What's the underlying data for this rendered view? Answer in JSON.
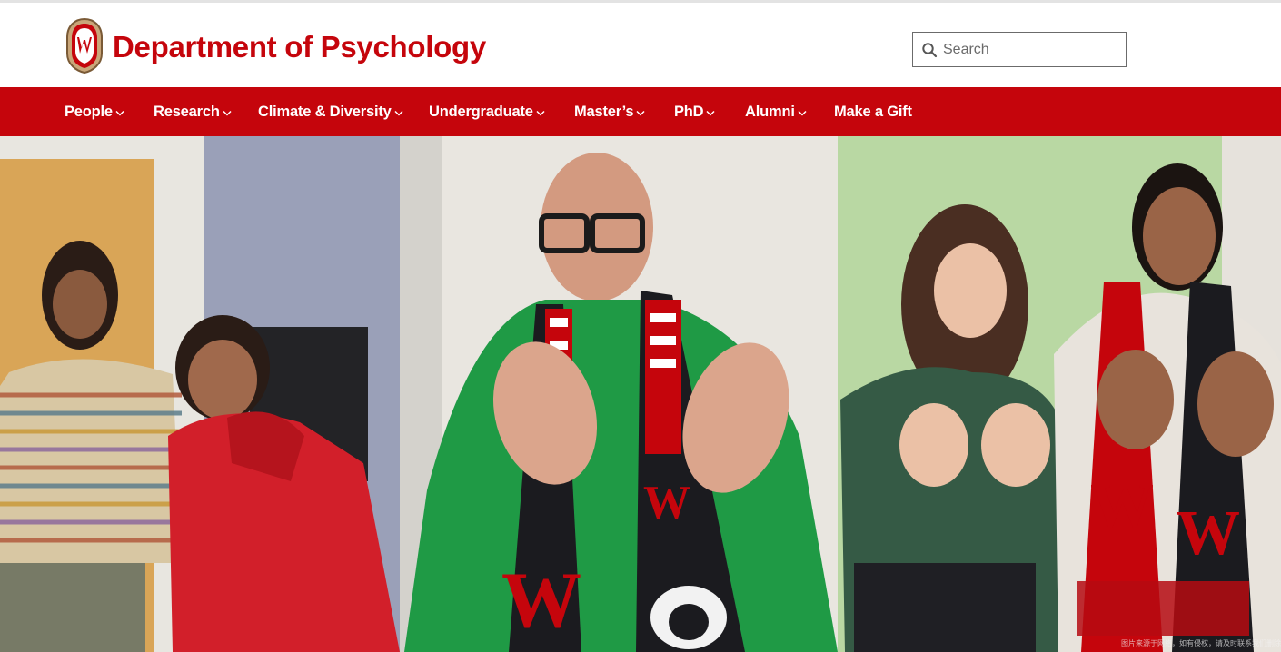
{
  "header": {
    "site_title": "Department of Psychology"
  },
  "search": {
    "placeholder": "Search",
    "value": ""
  },
  "nav": {
    "items": [
      {
        "label": "People",
        "has_dropdown": true
      },
      {
        "label": "Research",
        "has_dropdown": true
      },
      {
        "label": "Climate & Diversity",
        "has_dropdown": true
      },
      {
        "label": "Undergraduate",
        "has_dropdown": true
      },
      {
        "label": "Master’s",
        "has_dropdown": true
      },
      {
        "label": "PhD",
        "has_dropdown": true
      },
      {
        "label": "Alumni",
        "has_dropdown": true
      },
      {
        "label": "Make a Gift",
        "has_dropdown": false
      }
    ]
  },
  "hero": {
    "caption": "图片来源于网络，如有侵权，请及时联系我们删除"
  },
  "colors": {
    "brand_red": "#c5050c",
    "white": "#ffffff",
    "scarf_black": "#1b1b1f"
  },
  "icons": {
    "crest": "uw-crest-icon",
    "search": "search-icon",
    "dropdown": "chevron-down-icon"
  }
}
